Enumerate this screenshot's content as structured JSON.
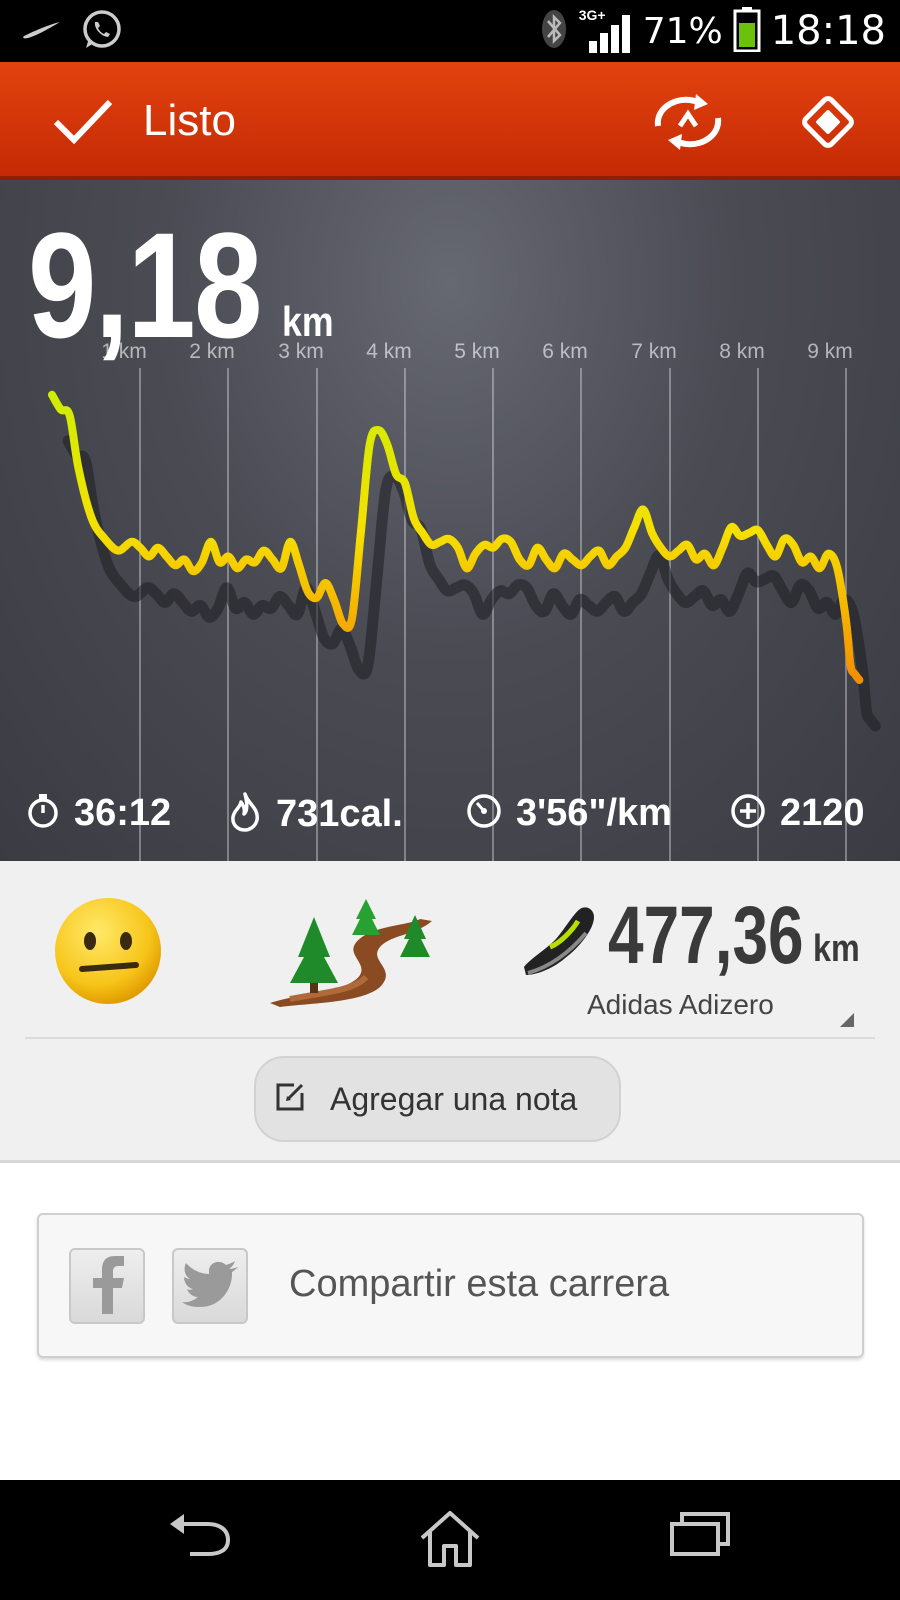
{
  "status_bar": {
    "network": "3G+",
    "battery_percent": "71%",
    "time": "18:18",
    "icons": [
      "nike-swoosh-icon",
      "whatsapp-icon",
      "bluetooth-icon",
      "signal-icon",
      "battery-icon"
    ]
  },
  "action_bar": {
    "title": "Listo",
    "icons": [
      "check-icon",
      "sync-icon",
      "navigation-icon"
    ],
    "color": "#d63a0a"
  },
  "run": {
    "distance_value": "9,18",
    "distance_unit": "km",
    "stats": {
      "duration": "36:12",
      "calories": "731cal.",
      "pace": "3'56\"/km",
      "fuel": "2120"
    }
  },
  "chart_data": {
    "type": "line",
    "title": "",
    "xlabel": "",
    "ylabel": "",
    "x_tick_labels": [
      "1 km",
      "2 km",
      "3 km",
      "4 km",
      "5 km",
      "6 km",
      "7 km",
      "8 km",
      "9 km"
    ],
    "xlim": [
      0,
      9.18
    ],
    "grid": "vertical",
    "gradient_colors": [
      "#c8f000",
      "#f5e000",
      "#f5a000",
      "#e04000"
    ],
    "series": [
      {
        "x": [
          0,
          0.1,
          0.2,
          0.3,
          0.45,
          0.6,
          0.75,
          0.9,
          1.0,
          1.1,
          1.2,
          1.3,
          1.4,
          1.5,
          1.6,
          1.7,
          1.8,
          1.9,
          2.0,
          2.1,
          2.2,
          2.3,
          2.4,
          2.5,
          2.6,
          2.7,
          2.8,
          2.9,
          3.0,
          3.1,
          3.2,
          3.3,
          3.4,
          3.5,
          3.6,
          3.7,
          3.8,
          3.9,
          4.0,
          4.1,
          4.2,
          4.3,
          4.4,
          4.5,
          4.6,
          4.7,
          4.8,
          4.9,
          5.0,
          5.1,
          5.2,
          5.3,
          5.4,
          5.5,
          5.6,
          5.7,
          5.8,
          5.9,
          6.0,
          6.1,
          6.2,
          6.3,
          6.4,
          6.5,
          6.6,
          6.7,
          6.8,
          6.9,
          7.0,
          7.1,
          7.2,
          7.3,
          7.4,
          7.5,
          7.6,
          7.7,
          7.8,
          7.9,
          8.0,
          8.1,
          8.2,
          8.3,
          8.4,
          8.5,
          8.6,
          8.7,
          8.8,
          8.9,
          9.0,
          9.05,
          9.1,
          9.15
        ],
        "y": [
          0.97,
          0.92,
          0.9,
          0.72,
          0.55,
          0.48,
          0.44,
          0.47,
          0.45,
          0.42,
          0.45,
          0.42,
          0.39,
          0.41,
          0.37,
          0.4,
          0.47,
          0.4,
          0.42,
          0.38,
          0.41,
          0.4,
          0.44,
          0.41,
          0.38,
          0.47,
          0.39,
          0.3,
          0.28,
          0.33,
          0.27,
          0.19,
          0.21,
          0.5,
          0.8,
          0.85,
          0.8,
          0.7,
          0.67,
          0.55,
          0.5,
          0.46,
          0.47,
          0.48,
          0.45,
          0.38,
          0.43,
          0.46,
          0.45,
          0.48,
          0.47,
          0.41,
          0.39,
          0.45,
          0.41,
          0.38,
          0.43,
          0.41,
          0.39,
          0.42,
          0.44,
          0.39,
          0.42,
          0.45,
          0.52,
          0.58,
          0.5,
          0.45,
          0.42,
          0.44,
          0.46,
          0.41,
          0.43,
          0.39,
          0.45,
          0.52,
          0.49,
          0.5,
          0.51,
          0.46,
          0.42,
          0.48,
          0.46,
          0.4,
          0.42,
          0.38,
          0.43,
          0.38,
          0.2,
          0.05,
          0.02,
          0.0
        ]
      }
    ]
  },
  "feedback": {
    "mood_icon": "neutral-face-icon",
    "terrain_icon": "trail-icon",
    "shoe_icon": "shoe-icon",
    "shoe_distance_value": "477,36",
    "shoe_distance_unit": "km",
    "shoe_name": "Adidas Adizero",
    "note_button": "Agregar una nota"
  },
  "share": {
    "label": "Compartir esta carrera",
    "icons": [
      "facebook-icon",
      "twitter-icon"
    ]
  },
  "nav_bar": {
    "icons": [
      "back-icon",
      "home-icon",
      "recent-apps-icon"
    ]
  }
}
